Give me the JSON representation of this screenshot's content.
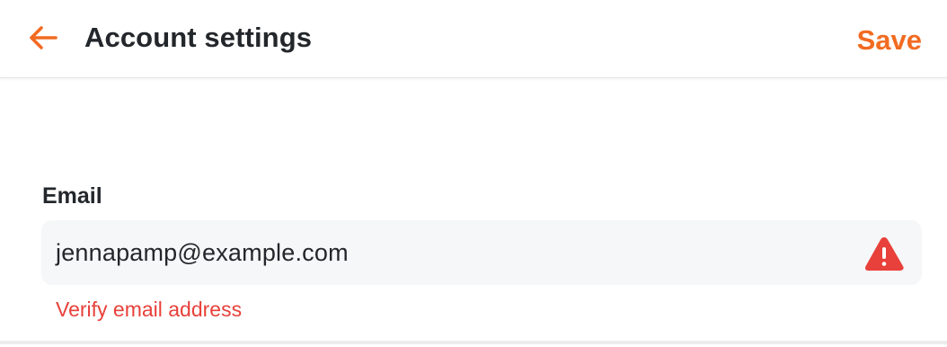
{
  "header": {
    "title": "Account settings",
    "back_icon": "arrow-left-icon",
    "save_label": "Save"
  },
  "email_field": {
    "label": "Email",
    "value": "jennapamp@example.com",
    "status_icon": "warning-triangle-icon",
    "error_message": "Verify email address"
  },
  "colors": {
    "accent": "#f26b21",
    "error": "#e8403a",
    "text": "#23272b",
    "input_background": "#f6f7f8"
  }
}
